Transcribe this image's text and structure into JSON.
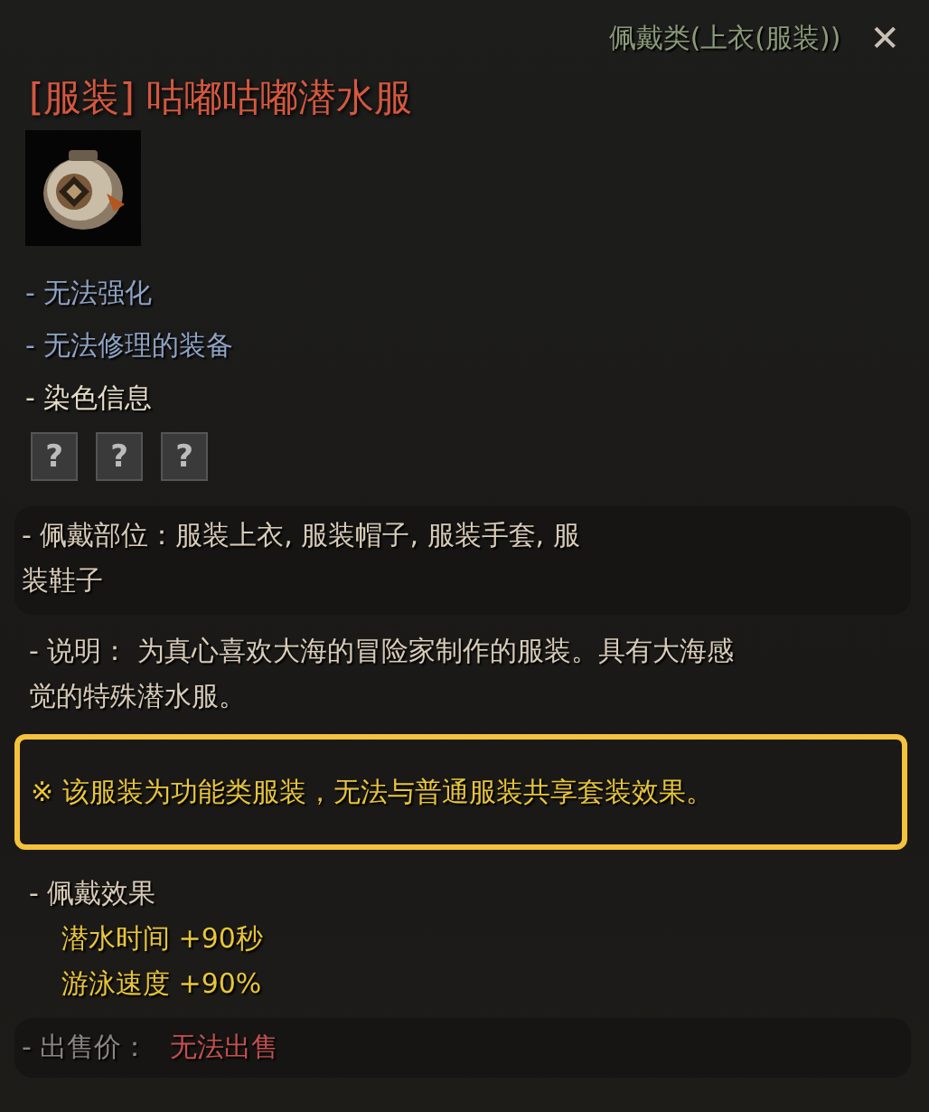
{
  "category": "佩戴类(上衣(服装))",
  "close": "✕",
  "title": "[服装] 咕嘟咕嘟潜水服",
  "properties": [
    {
      "text": "- 无法强化",
      "kind": "restriction"
    },
    {
      "text": "- 无法修理的装备",
      "kind": "restriction"
    },
    {
      "text": "- 染色信息",
      "kind": "heading"
    }
  ],
  "dye_slots": [
    "?",
    "?",
    "?"
  ],
  "wear_parts": {
    "lines": [
      "- 佩戴部位：服装上衣, 服装帽子, 服装手套, 服",
      "装鞋子"
    ]
  },
  "description": {
    "lines": [
      "- 说明：  为真心喜欢大海的冒险家制作的服装。具有大海感",
      "觉的特殊潜水服。"
    ]
  },
  "notice": "※ 该服装为功能类服装，无法与普通服装共享套装效果。",
  "effects": {
    "heading": "- 佩戴效果",
    "items": [
      "潜水时间 +90秒",
      "游泳速度 +90%"
    ]
  },
  "sell": {
    "label": "- 出售价：",
    "value": "无法出售"
  }
}
